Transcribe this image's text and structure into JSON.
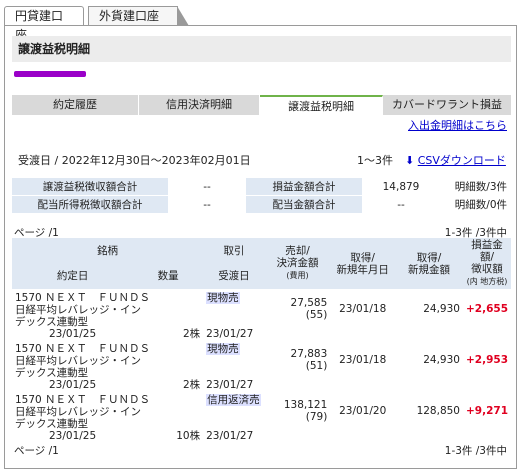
{
  "account_tabs": [
    "円貸建口座",
    "外貨建口座"
  ],
  "title": "譲渡益税明細",
  "subtabs": [
    "約定履歴",
    "信用決済明細",
    "譲渡益税明細",
    "カバードワラント損益"
  ],
  "inout_link": "入出金明細はこちら",
  "period": "受渡日 / 2022年12月30日〜2023年02月01日",
  "count": "1〜3件",
  "csv_label": "CSVダウンロード",
  "summary": [
    {
      "h1": "譲渡益税徴収額合計",
      "v1": "--",
      "h2": "損益金額合計",
      "v2": "14,879",
      "h3": "明細数/3件"
    },
    {
      "h1": "配当所得税徴収額合計",
      "v1": "--",
      "h2": "配当金額合計",
      "v2": "--",
      "h3": "明細数/0件"
    }
  ],
  "page_label": "ページ /1",
  "page_count": "1-3件 /3件中",
  "headers": {
    "stock": "銘柄",
    "trade": "取引",
    "sale": "売却/",
    "settle": "決済金額",
    "cost": "(費用)",
    "acq": "取得/",
    "acq_date": "新規年月日",
    "acq_amt": "取得/",
    "acq_amt2": "新規金額",
    "pl": "損益金額/",
    "tax": "徴収額",
    "tax_sub": "(内 地方税)",
    "date": "約定日",
    "qty": "数量",
    "deliv": "受渡日"
  },
  "rows": [
    {
      "name1": "1570 ＮＥＸＴ　ＦＵＮＤＳ",
      "name2": "日経平均レバレッジ・イン",
      "name3": "デックス連動型",
      "trade": "現物売",
      "sale": "27,585",
      "cost": "(55)",
      "acq_date": "23/01/18",
      "acq_amt": "24,930",
      "pl": "+2,655",
      "date": "23/01/25",
      "qty": "2株",
      "deliv": "23/01/27"
    },
    {
      "name1": "1570 ＮＥＸＴ　ＦＵＮＤＳ",
      "name2": "日経平均レバレッジ・イン",
      "name3": "デックス連動型",
      "trade": "現物売",
      "sale": "27,883",
      "cost": "(51)",
      "acq_date": "23/01/18",
      "acq_amt": "24,930",
      "pl": "+2,953",
      "date": "23/01/25",
      "qty": "2株",
      "deliv": "23/01/27"
    },
    {
      "name1": "1570 ＮＥＸＴ　ＦＵＮＤＳ",
      "name2": "日経平均レバレッジ・イン",
      "name3": "デックス連動型",
      "trade": "信用返済売",
      "sale": "138,121",
      "cost": "(79)",
      "acq_date": "23/01/20",
      "acq_amt": "128,850",
      "pl": "+9,271",
      "date": "23/01/25",
      "qty": "10株",
      "deliv": "23/01/27"
    }
  ]
}
